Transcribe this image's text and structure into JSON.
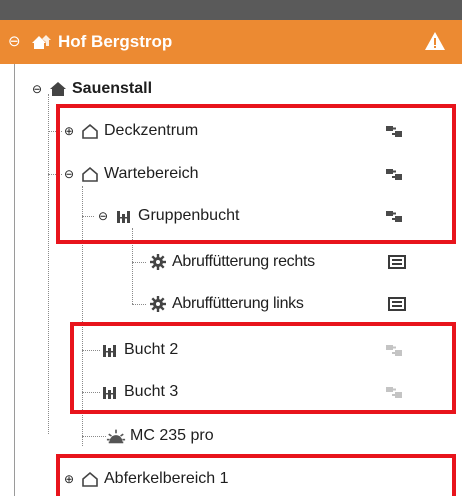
{
  "header": {
    "title": "Hof Bergstrop",
    "collapse_icon": "collapse-circle-icon",
    "farm_icon": "farm-house-icon",
    "warning_icon": "warning-triangle-icon"
  },
  "tree": {
    "barn": {
      "label": "Sauenstall",
      "icon": "barn-icon"
    },
    "deckzentrum": {
      "label": "Deckzentrum",
      "icon": "house-outline-icon",
      "status_icon": "plug-connected-icon"
    },
    "wartebereich": {
      "label": "Wartebereich",
      "icon": "house-outline-icon",
      "status_icon": "plug-connected-icon"
    },
    "gruppenbucht": {
      "label": "Gruppenbucht",
      "icon": "pen-icon",
      "status_icon": "plug-connected-icon"
    },
    "abruf_rechts": {
      "label": "Abruffütterung rechts",
      "icon": "gear-icon",
      "status_icon": "monitor-icon"
    },
    "abruf_links": {
      "label": "Abruffütterung links",
      "icon": "gear-icon",
      "status_icon": "monitor-icon"
    },
    "bucht2": {
      "label": "Bucht 2",
      "icon": "pen-icon",
      "status_icon": "plug-disconnected-icon"
    },
    "bucht3": {
      "label": "Bucht 3",
      "icon": "pen-icon",
      "status_icon": "plug-disconnected-icon"
    },
    "mc235": {
      "label": "MC 235 pro",
      "icon": "climate-sun-icon"
    },
    "abferkel": {
      "label": "Abferkelbereich 1",
      "icon": "house-outline-icon"
    }
  },
  "colors": {
    "header_bg": "#ec8a32",
    "highlight": "#e8141c",
    "status_active": "#4a4a4a",
    "status_inactive": "#c4c4c4"
  }
}
